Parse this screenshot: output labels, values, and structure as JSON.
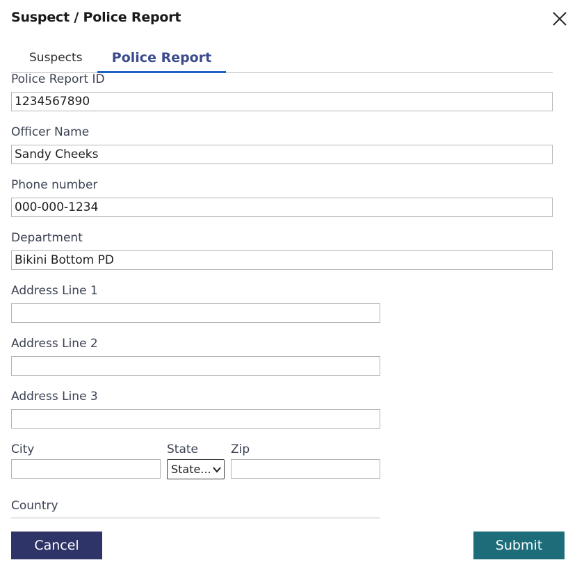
{
  "dialog": {
    "title": "Suspect / Police Report"
  },
  "tabs": [
    {
      "label": "Suspects",
      "active": false
    },
    {
      "label": "Police Report",
      "active": true
    }
  ],
  "form": {
    "police_report_id": {
      "label": "Police Report ID",
      "value": "1234567890"
    },
    "officer_name": {
      "label": "Officer Name",
      "value": "Sandy Cheeks"
    },
    "phone_number": {
      "label": "Phone number",
      "value": "000-000-1234"
    },
    "department": {
      "label": "Department",
      "value": "Bikini Bottom PD"
    },
    "address_line_1": {
      "label": "Address Line 1",
      "value": ""
    },
    "address_line_2": {
      "label": "Address Line 2",
      "value": ""
    },
    "address_line_3": {
      "label": "Address Line 3",
      "value": ""
    },
    "city": {
      "label": "City",
      "value": ""
    },
    "state": {
      "label": "State",
      "selected": "State..."
    },
    "zip": {
      "label": "Zip",
      "value": ""
    },
    "country": {
      "label": "Country"
    }
  },
  "buttons": {
    "cancel": "Cancel",
    "submit": "Submit"
  },
  "colors": {
    "tab_active_text": "#3a4a8c",
    "tab_underline": "#1f62c3",
    "cancel_bg": "#2f3468",
    "submit_bg": "#1d6c7a"
  },
  "icons": {
    "close": "close-icon",
    "select_arrow": "chevron-down-icon"
  }
}
